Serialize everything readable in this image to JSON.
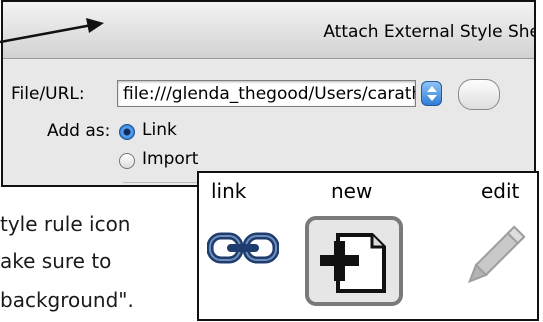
{
  "dialog": {
    "title": "Attach External Style She",
    "file_label": "File/URL:",
    "file_value": "file:///glenda_thegood/Users/carath",
    "add_as_label": "Add as:",
    "options": [
      {
        "label": "Link",
        "selected": true
      },
      {
        "label": "Import",
        "selected": false
      }
    ]
  },
  "caption": {
    "line1": "tyle rule icon",
    "line2": "ake sure to",
    "line3": "background\"."
  },
  "icons_panel": {
    "labels": [
      "link",
      "new",
      "edit"
    ],
    "icons": [
      "link-icon",
      "new-style-rule-icon",
      "edit-pencil-icon"
    ]
  },
  "colors": {
    "accent": "#2b74cf",
    "panel_border": "#111111"
  }
}
